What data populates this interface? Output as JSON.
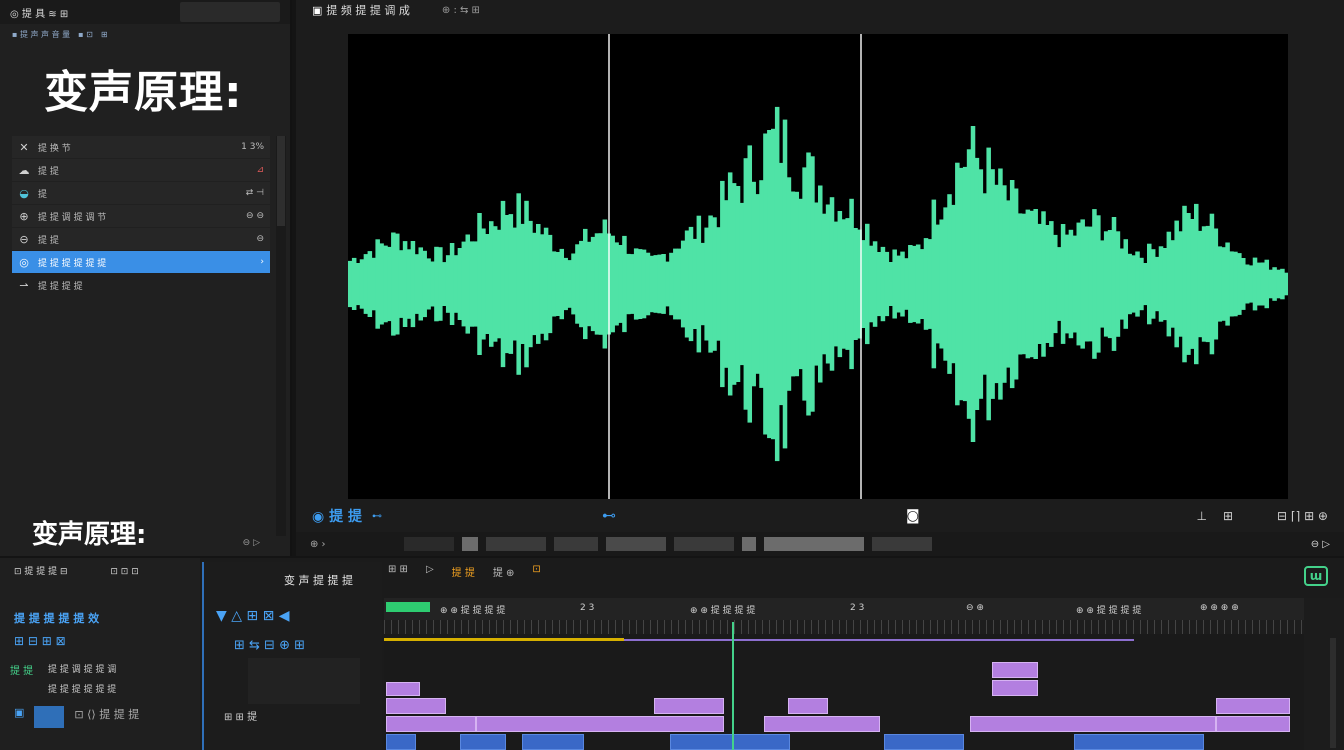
{
  "left_panel": {
    "header_label": "◎ 提 具 ≋ ⊞",
    "sub_items": [
      "▪ 提 声 声 音 量",
      "▪ ⊡",
      "⊞"
    ],
    "big_title": "变声原理:",
    "small_title": "变声原理:",
    "properties": [
      {
        "icon": "✕",
        "label": "提 换 节",
        "value": "1 3%"
      },
      {
        "icon": "☁",
        "label": "提 提",
        "value": "⊿"
      },
      {
        "icon": "◒",
        "label": "提",
        "value": "⇄ ⊣"
      },
      {
        "icon": "⊕",
        "label": "提 提 调 提 调 节",
        "value": "⊖ ⊖"
      },
      {
        "icon": "⊖",
        "label": "提 提",
        "value": "⊖"
      },
      {
        "icon": "◎",
        "label": "提 提 提 提 提 提",
        "value": "›"
      },
      {
        "icon": "⇀",
        "label": "提 提 提 提",
        "value": ""
      }
    ],
    "footer_icons": "⊖ ▷"
  },
  "viewer": {
    "title": "提 频 提 提 调 成",
    "title_icons": "⊕ : ⇆ ⊞",
    "controls_left": "◉ 提 提",
    "controls_mid": "⊷",
    "controls_right": [
      "⊥",
      "⊞",
      "⊟ ⌈⌉ ⊞ ⊕"
    ]
  },
  "effects": {
    "header": "⊡ 提 提 提 ⊟",
    "header_icons": "⊡ ⊡ ⊡",
    "blue_label": "提 提 提 提 提 效",
    "icon_row": "⊞ ⊟ ⊞ ⊠",
    "green_label": "提 提",
    "line1": "提 提 调 提 提 调",
    "line2": "提 提 提 提 提 提",
    "bottom_icons": "⊡ ⟨⟩ 提 提 提"
  },
  "inspector": {
    "title": "变 声 提 提 提",
    "icons_row1": "▼ △ ⊞ ⊠ ◀",
    "icons_row2": "⊞ ⇆ ⊟ ⊕ ⊞",
    "bottom": "⊞ ⊞ 提"
  },
  "timeline_toolbar": [
    "⊞ ⊞",
    "▷",
    "提 提",
    "提 ⊕",
    "⊡"
  ],
  "timeline": {
    "ruler_labels": [
      "⊕ ⊕ 提 提 提 提",
      "2 3",
      "⊕ ⊕ 提 提 提 提",
      "2 3",
      "⊖ ⊕",
      "⊕ ⊕ 提 提 提 提",
      "⊕ ⊕ ⊕ ⊕"
    ]
  },
  "waveform": {
    "color": "#4fe3a6",
    "marker_color": "#ffffff",
    "background": "#000000",
    "envelope": [
      0.15,
      0.2,
      0.25,
      0.3,
      0.25,
      0.2,
      0.18,
      0.25,
      0.35,
      0.4,
      0.5,
      0.45,
      0.35,
      0.25,
      0.2,
      0.3,
      0.35,
      0.3,
      0.2,
      0.15,
      0.2,
      0.3,
      0.35,
      0.45,
      0.6,
      0.7,
      0.85,
      0.95,
      0.8,
      0.7,
      0.6,
      0.5,
      0.45,
      0.3,
      0.2,
      0.18,
      0.25,
      0.5,
      0.7,
      0.85,
      0.75,
      0.6,
      0.5,
      0.4,
      0.35,
      0.3,
      0.35,
      0.4,
      0.35,
      0.25,
      0.18,
      0.25,
      0.35,
      0.45,
      0.4,
      0.3,
      0.2,
      0.15,
      0.12,
      0.1
    ]
  }
}
